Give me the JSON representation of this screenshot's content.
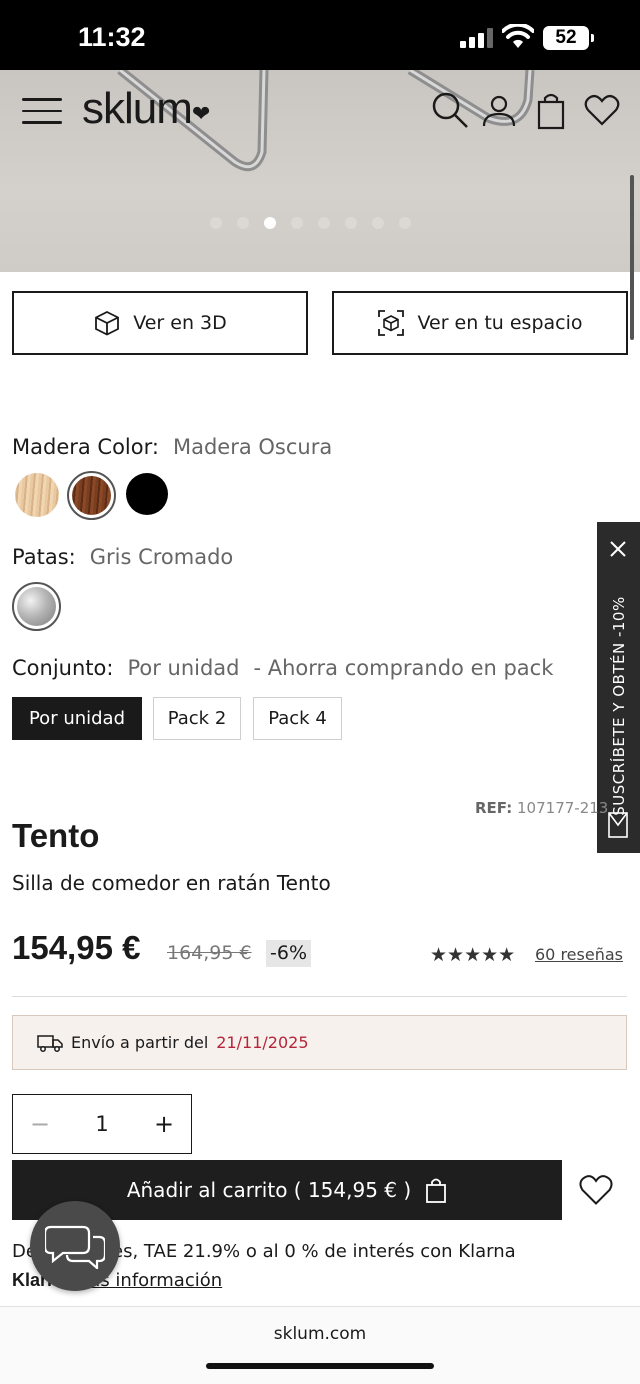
{
  "status": {
    "time": "11:32",
    "battery": "52"
  },
  "header": {
    "logo": "sklum",
    "logo_heart": "❤"
  },
  "carousel": {
    "dots": 8,
    "active": 2
  },
  "view_buttons": {
    "ver_3d": "Ver en 3D",
    "ver_espacio": "Ver en tu espacio"
  },
  "options": {
    "madera": {
      "label": "Madera Color:",
      "value": "Madera Oscura",
      "swatches": [
        "light-wood",
        "dark-wood",
        "black"
      ],
      "selected": 1
    },
    "patas": {
      "label": "Patas:",
      "value": "Gris Cromado"
    },
    "conjunto": {
      "label": "Conjunto:",
      "value": "Por unidad",
      "hint": "- Ahorra comprando en pack",
      "packs": [
        "Por unidad",
        "Pack 2",
        "Pack 4"
      ]
    }
  },
  "side_tab": {
    "label": "SUSCRÍBETE Y OBTÉN -10%"
  },
  "product": {
    "ref_label": "REF:",
    "ref_value": "107177-213",
    "title": "Tento",
    "subtitle": "Silla de comedor en ratán Tento",
    "price": "154,95 €",
    "old_price": "164,95 €",
    "discount": "-6%",
    "rating_stars": "★★★★★",
    "rating": 5,
    "reviews": "60 reseñas"
  },
  "shipping": {
    "text": "Envío a partir del",
    "date": "21/11/2025"
  },
  "quantity": {
    "value": "1",
    "minus": "−",
    "plus": "+"
  },
  "cart": {
    "label": "Añadir al carrito ( 154,95 € )"
  },
  "klarna": {
    "line1": "De         /mes, TAE 21.9% o al 0 % de interés con Klarna",
    "logo": "Klarna",
    "more": "Más información"
  },
  "browser": {
    "url": "sklum.com"
  },
  "colors": {
    "accent_dark": "#1e1e1e",
    "shipping_date": "#b5253a",
    "shipping_bg": "#f6f1ed"
  }
}
